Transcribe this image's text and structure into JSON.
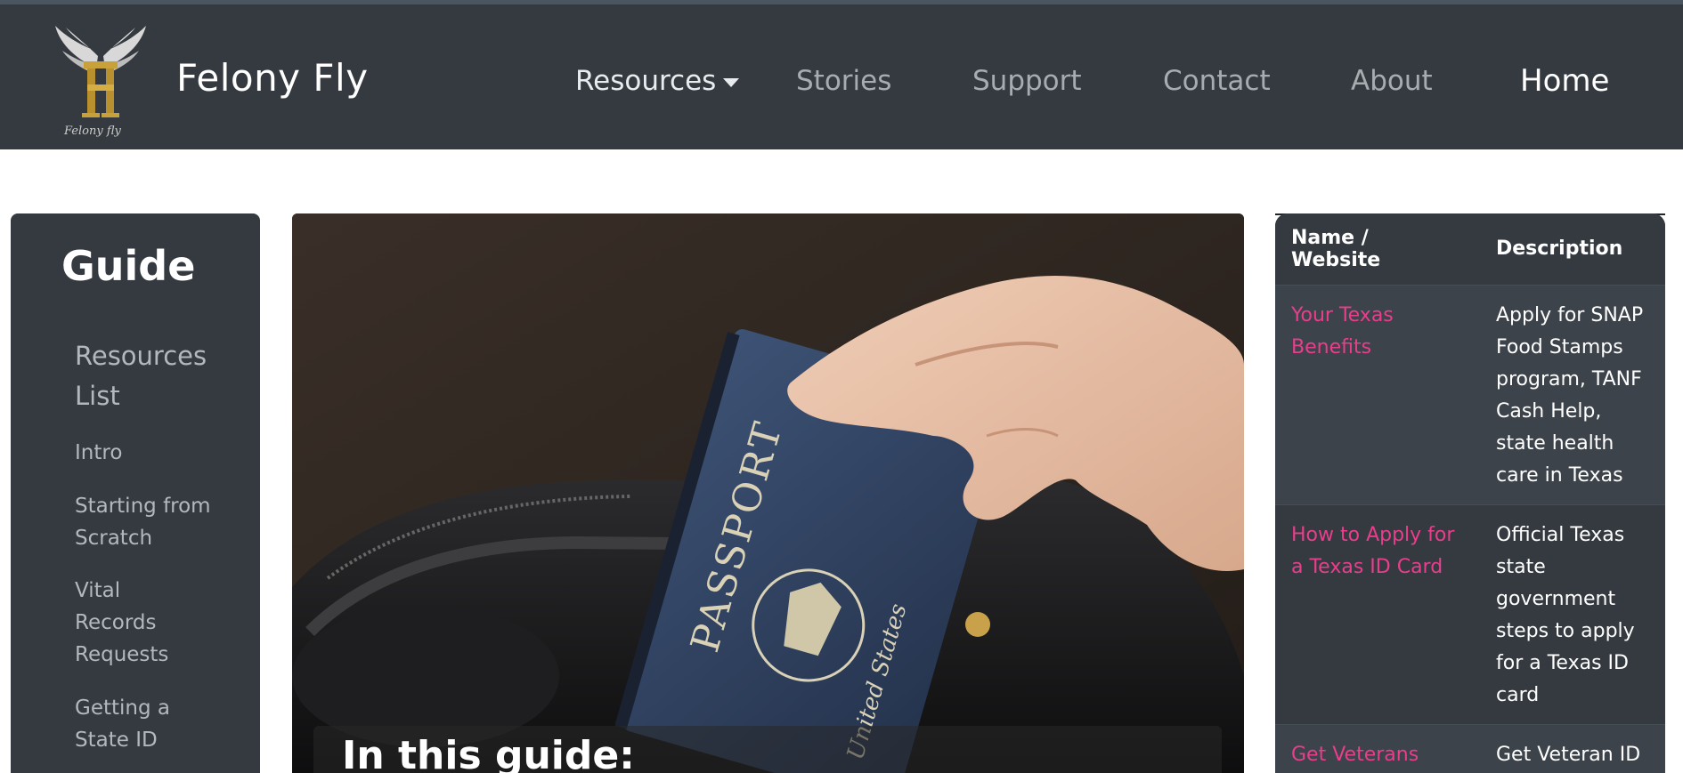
{
  "navbar": {
    "brand": "Felony Fly",
    "items": [
      {
        "label": "Resources",
        "has_dropdown": true
      },
      {
        "label": "Stories"
      },
      {
        "label": "Support"
      },
      {
        "label": "Contact"
      },
      {
        "label": "About"
      },
      {
        "label": "Home",
        "active": true
      }
    ]
  },
  "sidebar": {
    "title": "Guide",
    "links": [
      {
        "label": "Resources List"
      },
      {
        "label": "Intro"
      },
      {
        "label": "Starting from Scratch"
      },
      {
        "label": "Vital Records Requests"
      },
      {
        "label": "Getting a State ID"
      }
    ]
  },
  "hero": {
    "image_subject": "hand placing a United States passport into a black bag",
    "caption": "In this guide:"
  },
  "resources_table": {
    "headers": [
      "Name / Website",
      "Description"
    ],
    "rows": [
      {
        "name": "Your Texas Benefits",
        "description": "Apply for SNAP Food Stamps program, TANF Cash Help, state health care in Texas"
      },
      {
        "name": "How to Apply for a Texas ID Card",
        "description": "Official Texas state government steps to apply for a Texas ID card"
      },
      {
        "name": "Get Veterans",
        "description": "Get Veteran ID"
      }
    ]
  },
  "colors": {
    "navbar_bg": "#343a40",
    "link_pink": "#e83e8c",
    "nav_text_muted": "#a8acb0",
    "page_bg": "#ffffff"
  }
}
